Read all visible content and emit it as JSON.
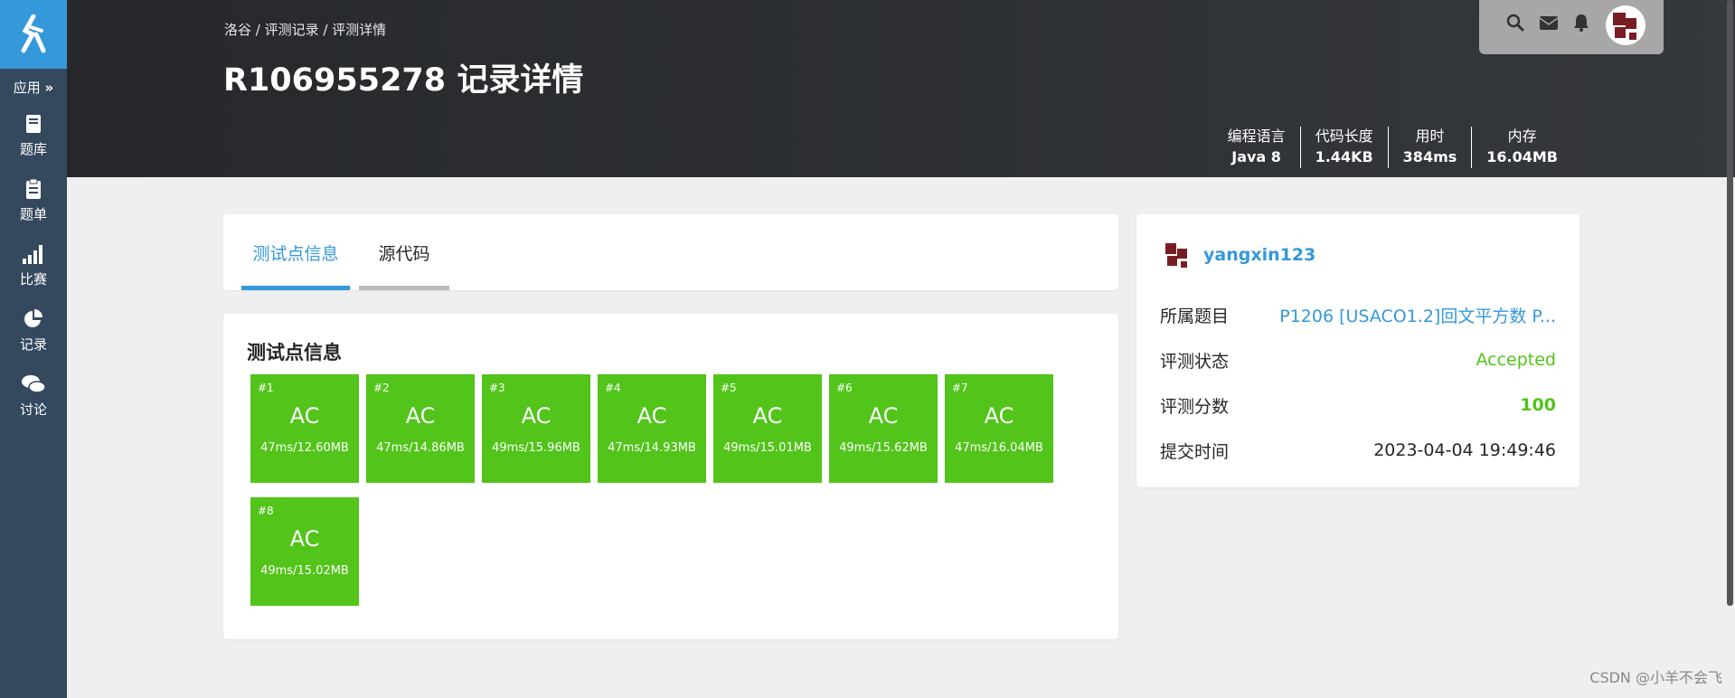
{
  "sidebar": {
    "apps_label": "应用",
    "items": [
      {
        "label": "题库",
        "icon": "book-icon"
      },
      {
        "label": "题单",
        "icon": "clipboard-icon"
      },
      {
        "label": "比赛",
        "icon": "bar-signal-icon"
      },
      {
        "label": "记录",
        "icon": "pie-chart-icon"
      },
      {
        "label": "讨论",
        "icon": "comments-icon"
      }
    ]
  },
  "header": {
    "breadcrumb": "洛谷 / 评测记录 / 评测详情",
    "title": "R106955278 记录详情",
    "stats": [
      {
        "label": "编程语言",
        "value": "Java 8"
      },
      {
        "label": "代码长度",
        "value": "1.44KB"
      },
      {
        "label": "用时",
        "value": "384ms"
      },
      {
        "label": "内存",
        "value": "16.04MB"
      }
    ]
  },
  "tabs": [
    {
      "label": "测试点信息",
      "active": true
    },
    {
      "label": "源代码",
      "active": false
    }
  ],
  "testcases": {
    "title": "测试点信息",
    "color": "#52c41a",
    "items": [
      {
        "index": "#1",
        "status": "AC",
        "result": "47ms/12.60MB"
      },
      {
        "index": "#2",
        "status": "AC",
        "result": "47ms/14.86MB"
      },
      {
        "index": "#3",
        "status": "AC",
        "result": "49ms/15.96MB"
      },
      {
        "index": "#4",
        "status": "AC",
        "result": "47ms/14.93MB"
      },
      {
        "index": "#5",
        "status": "AC",
        "result": "49ms/15.01MB"
      },
      {
        "index": "#6",
        "status": "AC",
        "result": "49ms/15.62MB"
      },
      {
        "index": "#7",
        "status": "AC",
        "result": "47ms/16.04MB"
      },
      {
        "index": "#8",
        "status": "AC",
        "result": "49ms/15.02MB"
      }
    ]
  },
  "info": {
    "username": "yangxin123",
    "problem_label": "所属题目",
    "problem_value": "P1206 [USACO1.2]回文平方数 P...",
    "status_label": "评测状态",
    "status_value": "Accepted",
    "score_label": "评测分数",
    "score_value": "100",
    "time_label": "提交时间",
    "time_value": "2023-04-04 19:49:46"
  },
  "watermark": "CSDN @小羊不会飞",
  "colors": {
    "accent": "#3498db",
    "accepted": "#52c41a",
    "sidebar": "#34495e"
  }
}
